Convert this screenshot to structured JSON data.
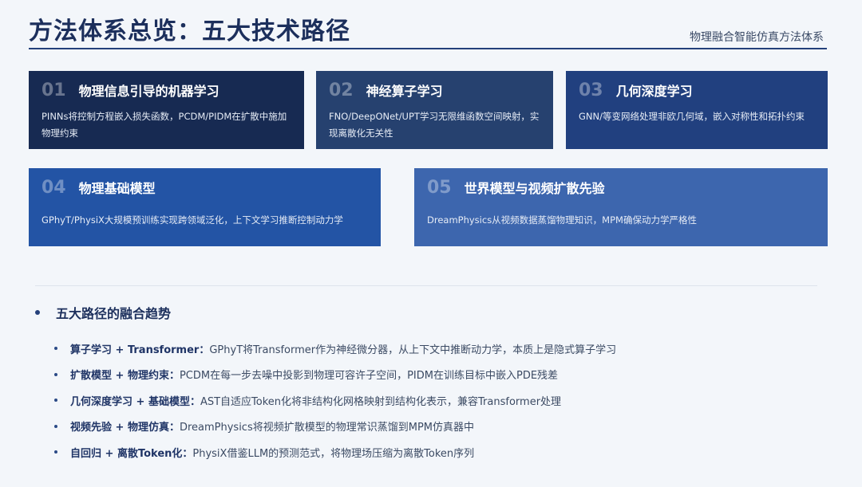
{
  "header": {
    "title": "方法体系总览：五大技术路径",
    "subtitle": "物理融合智能仿真方法体系"
  },
  "cards": [
    {
      "num": "01",
      "title": "物理信息引导的机器学习",
      "desc": "PINNs将控制方程嵌入损失函数，PCDM/PIDM在扩散中施加物理约束"
    },
    {
      "num": "02",
      "title": "神经算子学习",
      "desc": "FNO/DeepONet/UPT学习无限维函数空间映射，实现离散化无关性"
    },
    {
      "num": "03",
      "title": "几何深度学习",
      "desc": "GNN/等变网络处理非欧几何域，嵌入对称性和拓扑约束"
    },
    {
      "num": "04",
      "title": "物理基础模型",
      "desc": "GPhyT/PhysiX大规模预训练实现跨领域泛化，上下文学习推断控制动力学"
    },
    {
      "num": "05",
      "title": "世界模型与视频扩散先验",
      "desc": "DreamPhysics从视频数据蒸馏物理知识，MPM确保动力学严格性"
    }
  ],
  "trends": {
    "title": "五大路径的融合趋势",
    "items": [
      {
        "label": "算子学习 + Transformer：",
        "text": "GPhyT将Transformer作为神经微分器，从上下文中推断动力学，本质上是隐式算子学习"
      },
      {
        "label": "扩散模型 + 物理约束：",
        "text": "PCDM在每一步去噪中投影到物理可容许子空间，PIDM在训练目标中嵌入PDE残差"
      },
      {
        "label": "几何深度学习 + 基础模型：",
        "text": "AST自适应Token化将非结构化网格映射到结构化表示，兼容Transformer处理"
      },
      {
        "label": "视频先验 + 物理仿真：",
        "text": "DreamPhysics将视频扩散模型的物理常识蒸馏到MPM仿真器中"
      },
      {
        "label": "自回归 + 离散Token化：",
        "text": "PhysiX借鉴LLM的预测范式，将物理场压缩为离散Token序列"
      }
    ]
  },
  "colors": {
    "title": "#1c2f5c",
    "card_1": "#172a52",
    "card_2": "#26416f",
    "card_3": "#21407f",
    "card_4": "#2354a5",
    "card_5": "#3d66ae",
    "background": "#f3f6fa"
  }
}
